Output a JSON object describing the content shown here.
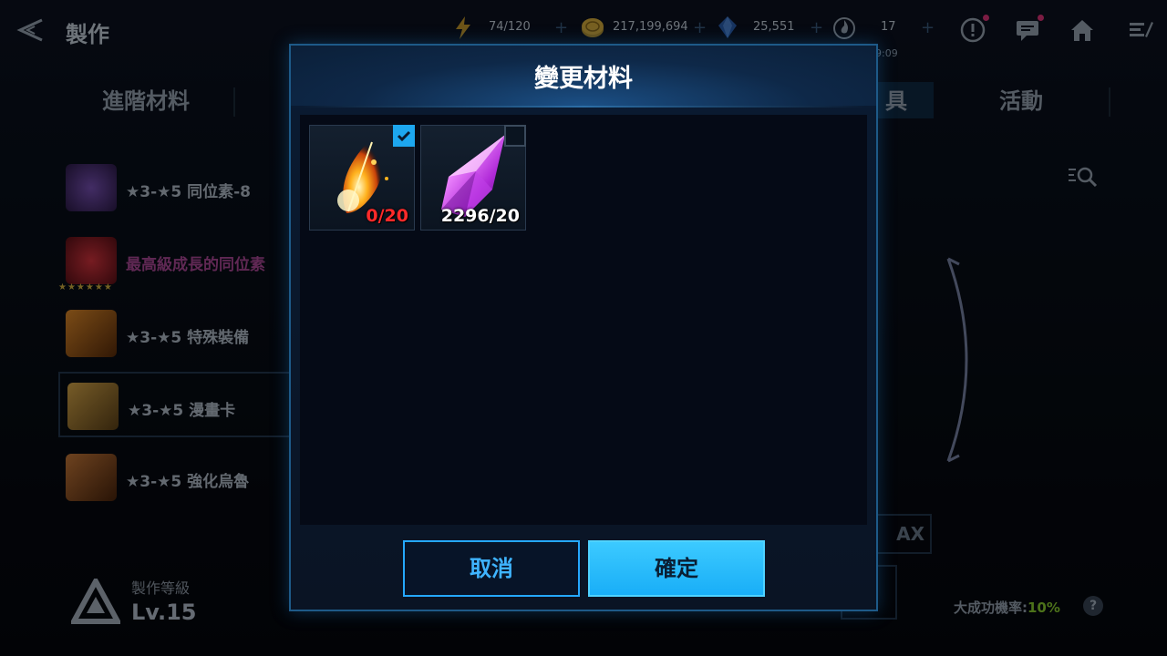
{
  "header": {
    "title": "製作",
    "resources": [
      {
        "icon": "energy-icon",
        "value": "74/120"
      },
      {
        "icon": "gold-coin-icon",
        "value": "217,199,694"
      },
      {
        "icon": "crystal-icon",
        "value": "25,551"
      },
      {
        "icon": "flame-icon",
        "value": "17"
      }
    ],
    "timer_partial": "9:09"
  },
  "tabs": [
    {
      "label": "進階材料"
    },
    {
      "label": "具"
    },
    {
      "label": "活動"
    }
  ],
  "craft_list": [
    {
      "label": "★3-★5 同位素-8",
      "thumb_color": "#5a3a8a"
    },
    {
      "label": "最高級成長的同位素",
      "thumb_color": "#a3202e",
      "stars": "★★★★★★"
    },
    {
      "label": "★3-★5 特殊裝備",
      "thumb_color": "#b86a1e"
    },
    {
      "label": "★3-★5 漫畫卡",
      "thumb_color": "#b88a2e"
    },
    {
      "label": "★3-★5 強化烏魯",
      "thumb_color": "#a8642a"
    }
  ],
  "craft_level": {
    "label": "製作等級",
    "value": "Lv.15"
  },
  "max_label": "AX",
  "success_rate": {
    "label": "大成功機率:",
    "value": "10%"
  },
  "modal": {
    "title": "變更材料",
    "materials": [
      {
        "name": "phoenix-feather",
        "count": "0/20",
        "selected": true,
        "insufficient": true
      },
      {
        "name": "purple-crystal",
        "count": "2296/20",
        "selected": false,
        "insufficient": false
      }
    ],
    "cancel_label": "取消",
    "confirm_label": "確定"
  },
  "colors": {
    "accent": "#1da7ef",
    "insufficient": "#ff2a2a",
    "rate_green": "#8bcf30"
  }
}
